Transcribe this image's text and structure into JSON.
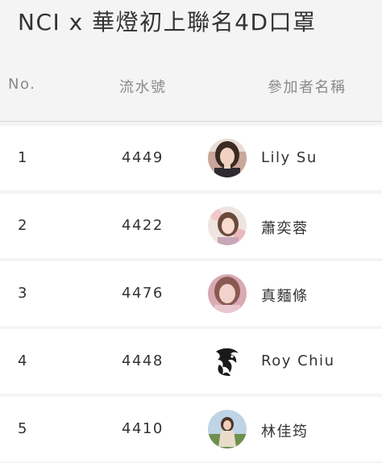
{
  "title": "NCI x 華燈初上聯名4D口罩",
  "columns": {
    "no": "No.",
    "serial": "流水號",
    "name": "參加者名稱"
  },
  "rows": [
    {
      "no": "1",
      "serial": "4449",
      "name": "Lily Su",
      "avatar": "portrait-photo"
    },
    {
      "no": "2",
      "serial": "4422",
      "name": "蕭奕蓉",
      "avatar": "portrait-photo"
    },
    {
      "no": "3",
      "serial": "4476",
      "name": "真麵條",
      "avatar": "portrait-photo"
    },
    {
      "no": "4",
      "serial": "4448",
      "name": "Roy Chiu",
      "avatar": "dragon-logo"
    },
    {
      "no": "5",
      "serial": "4410",
      "name": "林佳筠",
      "avatar": "portrait-photo"
    }
  ],
  "colors": {
    "background": "#f4f4f4",
    "row_background": "#ffffff",
    "text": "#333333",
    "header_text": "#8a8a8a"
  }
}
